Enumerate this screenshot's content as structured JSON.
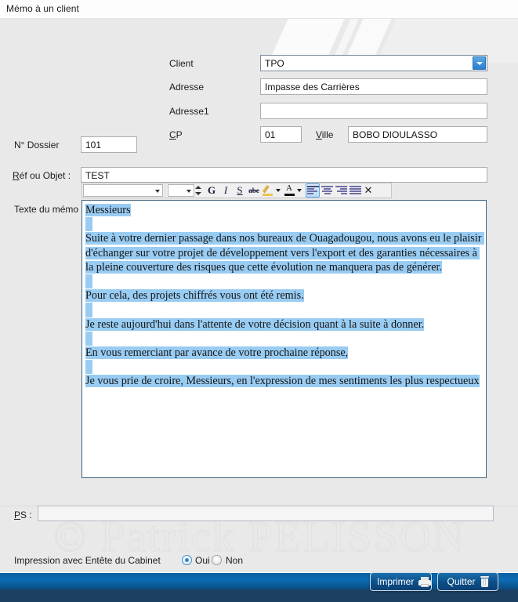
{
  "window": {
    "title": "Mémo à un client"
  },
  "form": {
    "client_label": "Client",
    "client_value": "TPO",
    "adresse_label": "Adresse",
    "adresse_value": "Impasse des Carrières",
    "adresse1_label": "Adresse1",
    "adresse1_value": "",
    "cp_label": "CP",
    "cp_value": "01",
    "ville_label": "Ville",
    "ville_value": "BOBO DIOULASSO",
    "dossier_label": "N° Dossier",
    "dossier_value": "101",
    "ref_label": "Réf ou Objet :",
    "ref_value": "TEST",
    "memo_label": "Texte du mémo",
    "ps_label": "PS :",
    "ps_value": ""
  },
  "toolbar": {
    "font_value": "",
    "size_value": "",
    "bold_label": "G",
    "italic_label": "I",
    "underline_label": "S",
    "strike_label": "abc",
    "highlight_label": "",
    "fontcolor_label": "A",
    "close_label": "✕"
  },
  "memo": {
    "paragraphs": [
      "Messieurs",
      "",
      "Suite à votre dernier passage dans nos bureaux de Ouagadougou, nous avons eu le plaisir d'échanger sur votre projet de développement vers l'export et des garanties nécessaires à la pleine couverture des risques que cette évolution ne manquera pas de générer.",
      "",
      "Pour cela, des projets chiffrés vous ont été remis.",
      "",
      "Je reste aujourd'hui dans l'attente de votre décision quant à la suite à donner.",
      "",
      "En vous remerciant par avance de votre prochaine réponse,",
      "",
      "Je vous prie de croire, Messieurs, en l'expression de mes sentiments les plus respectueux"
    ]
  },
  "options": {
    "entete_label": "Impression avec Entête du Cabinet",
    "oui_label": "Oui",
    "non_label": "Non",
    "selected": "Oui"
  },
  "footer": {
    "print_label": "Imprimer",
    "quit_label": "Quitter"
  },
  "watermark": {
    "text": "© Patrick PELISSON"
  },
  "colors": {
    "accent_blue": "#0d6cb4",
    "selection_blue": "#99ccf3",
    "bar_navy": "#1c4063",
    "page_bg": "#e9e9e9"
  }
}
